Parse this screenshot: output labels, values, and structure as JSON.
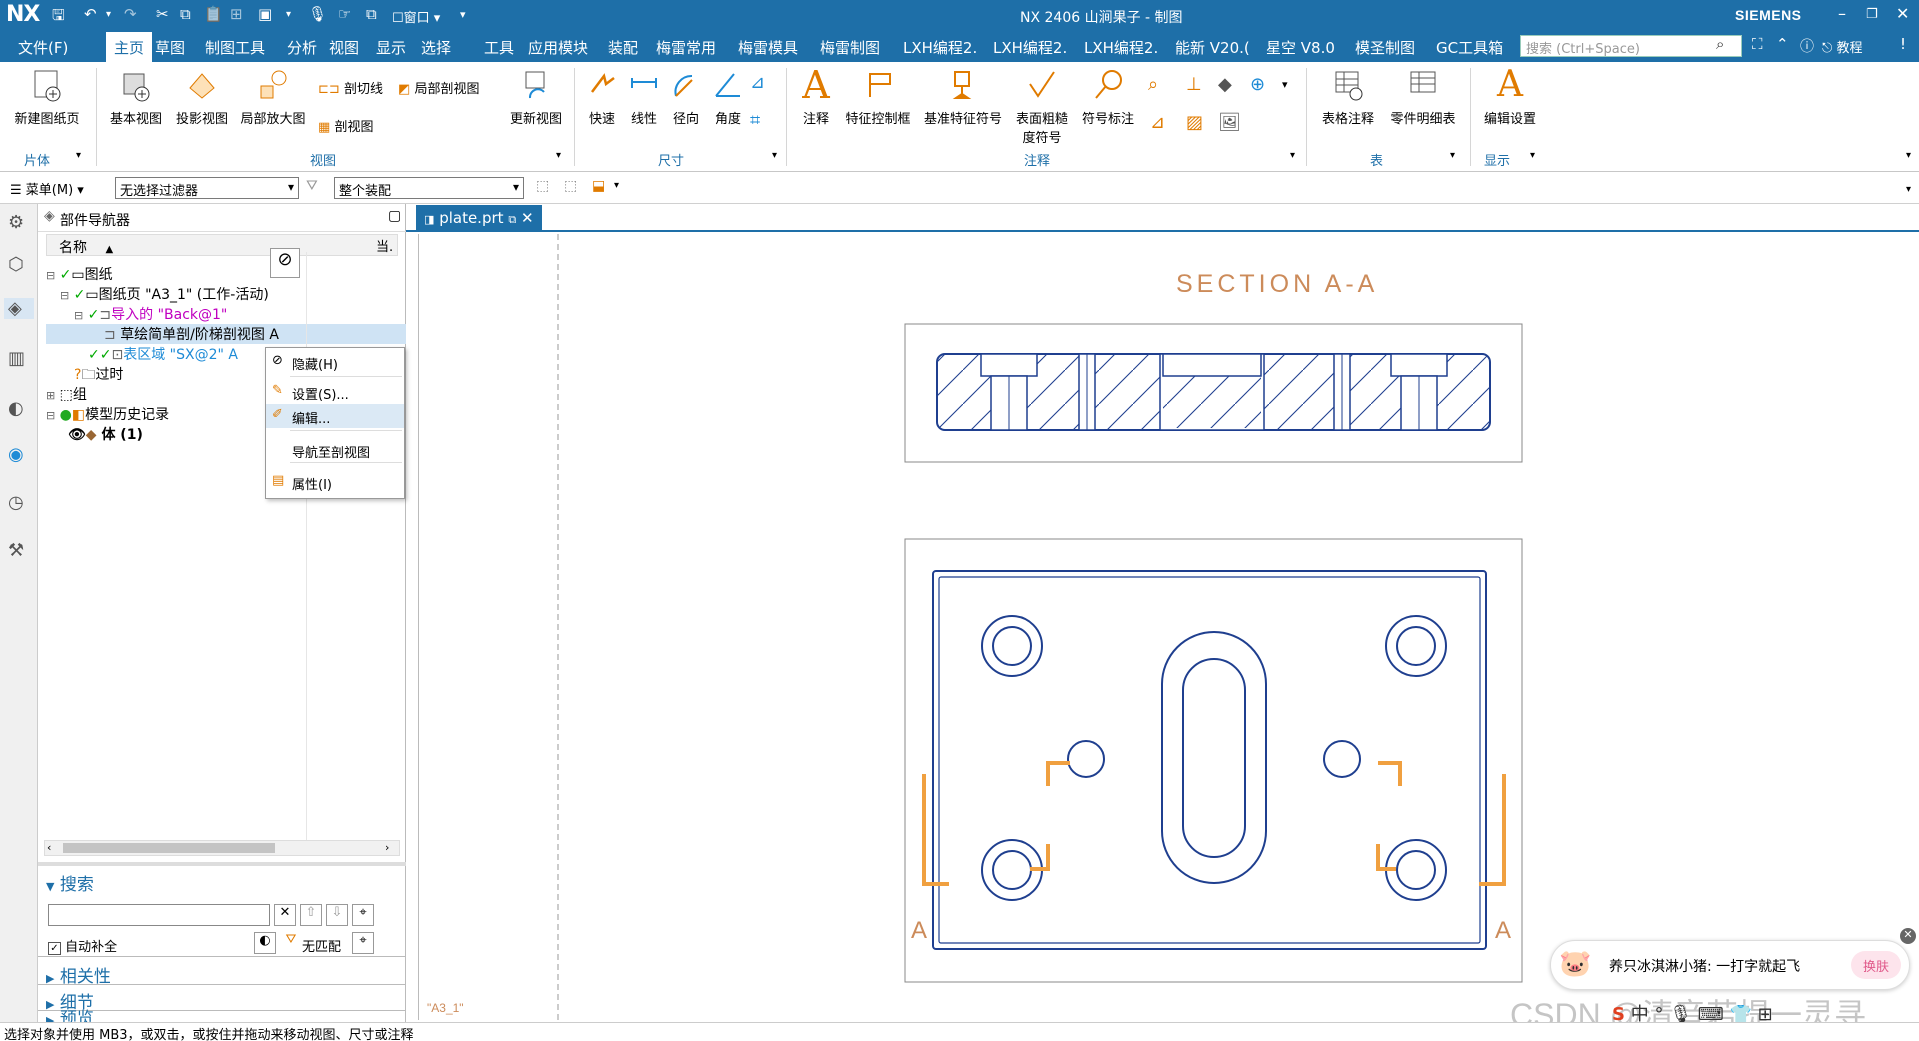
{
  "app": {
    "logo": "NX",
    "window_title": "NX 2406 山涧果子 - 制图",
    "brand": "SIEMENS",
    "qa_window": "窗口"
  },
  "menu": {
    "items": [
      "文件(F)",
      "主页",
      "草图",
      "制图工具",
      "分析",
      "视图",
      "显示",
      "选择",
      "工具",
      "应用模块",
      "装配",
      "梅雷常用",
      "梅雷模具",
      "梅雷制图",
      "LXH编程2.",
      "LXH编程2.",
      "LXH编程2.",
      "能新 V20.(",
      "星空 V8.0",
      "模圣制图",
      "GC工具箱"
    ],
    "active_index": 1,
    "search_placeholder": "搜索 (Ctrl+Space)",
    "tutorial": "教程"
  },
  "ribbon": {
    "buttons": {
      "new_sheet": "新建图纸页",
      "base_view": "基本视图",
      "proj_view": "投影视图",
      "detail_view": "局部放大图",
      "section_line": "剖切线",
      "partial_section": "局部剖视图",
      "section_view": "剖视图",
      "update_view": "更新视图",
      "rapid": "快速",
      "linear": "线性",
      "radial": "径向",
      "angular": "角度",
      "note": "注释",
      "fcf": "特征控制框",
      "datum": "基准特征符号",
      "surface": "表面粗糙",
      "surface2": "度符号",
      "id_symbol": "符号标注",
      "table_note": "表格注释",
      "parts_list": "零件明细表",
      "edit_settings": "编辑设置"
    },
    "groups": {
      "sheet": "片体",
      "view": "视图",
      "dim": "尺寸",
      "annot": "注释",
      "table": "表",
      "display": "显示"
    }
  },
  "toolbar2": {
    "menu_label": "菜单(M)",
    "filter": "无选择过滤器",
    "assembly": "整个装配"
  },
  "navigator": {
    "title": "部件导航器",
    "col_name": "名称",
    "col_current": "当.",
    "tree": {
      "drawing": "图纸",
      "sheet": "图纸页 \"A3_1\" (工作-活动)",
      "imported": "导入的 \"Back@1\"",
      "sketch_section": "草绘简单剖/阶梯剖视图 A",
      "surface_region": "表区域 \"SX@2\" A",
      "outdated": "过时",
      "group": "组",
      "history": "模型历史记录",
      "body": "体 (1)"
    }
  },
  "context_menu": {
    "hide": "隐藏(H)",
    "settings": "设置(S)...",
    "edit": "编辑...",
    "nav_section": "导航至剖视图",
    "properties": "属性(I)"
  },
  "search_panel": {
    "title": "搜索",
    "autocomplete": "自动补全",
    "no_match": "无匹配"
  },
  "panels": {
    "relevance": "相关性",
    "details": "细节",
    "preview": "预览"
  },
  "tab": {
    "file": "plate.prt"
  },
  "drawing": {
    "section_label": "SECTION A-A",
    "sheet_label": "\"A3_1\"",
    "cut_label": "A"
  },
  "status": {
    "text": "选择对象并使用 MB3，或双击，或按住并拖动来移动视图、尺寸或注释"
  },
  "popup": {
    "text": "养只冰淇淋小猪: 一打字就起飞",
    "button": "换肤"
  },
  "watermark": "CSDN @清音若提一灵寻"
}
